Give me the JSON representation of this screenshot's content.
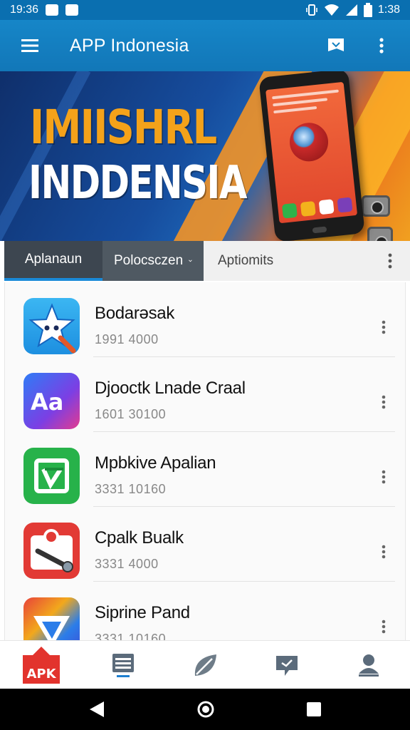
{
  "status_bar": {
    "time_left": "19:36",
    "time_right": "1:38"
  },
  "app_bar": {
    "title": "APP Indonesia",
    "menu_icon": "hamburger-menu-icon",
    "actions": [
      "flag-icon",
      "more-vert-icon"
    ]
  },
  "banner": {
    "line1": "IMIISHRL",
    "line2": "INDDENSIA",
    "colors": {
      "orange": "#f4a21a",
      "blue": "#164d9e"
    }
  },
  "tabs": [
    {
      "label": "Aplanaun",
      "active": true
    },
    {
      "label": "Polocsczen",
      "dropdown": true
    },
    {
      "label": "Aptiomits"
    }
  ],
  "apps": [
    {
      "name": "Bodarəsak",
      "meta": "1991 4000",
      "icon": "star-app-icon"
    },
    {
      "name": "Djooctk Lnade Craal",
      "meta": "1601 30100",
      "icon": "aa-app-icon"
    },
    {
      "name": "Mpbkive Apalian",
      "meta": "3331 10160",
      "icon": "green-app-icon"
    },
    {
      "name": "Cpalk Bualk",
      "meta": "3331 4000",
      "icon": "red-app-icon"
    },
    {
      "name": "Siprine Pand",
      "meta": "3331 10160",
      "icon": "gradient-app-icon"
    }
  ],
  "bottom_nav": [
    {
      "label": "APK",
      "icon": "apk-home-icon",
      "active": true
    },
    {
      "icon": "list-icon"
    },
    {
      "icon": "leaf-icon"
    },
    {
      "icon": "chat-icon"
    },
    {
      "icon": "profile-icon"
    }
  ]
}
